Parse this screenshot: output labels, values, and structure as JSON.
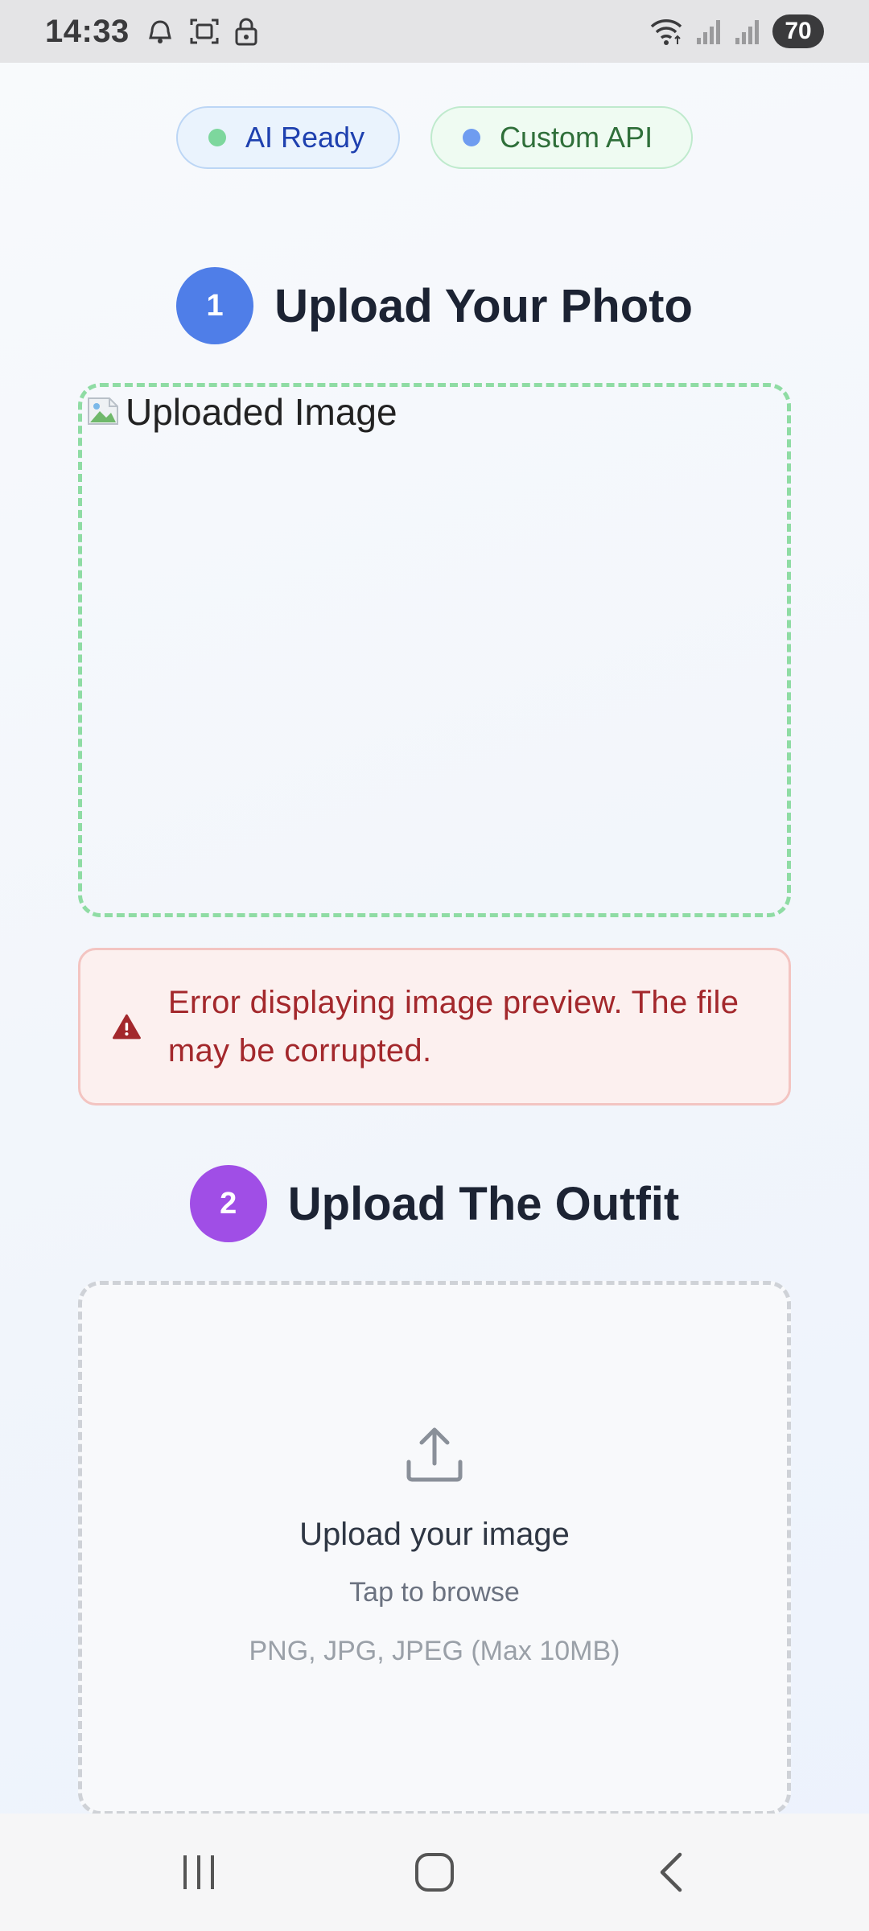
{
  "status_bar": {
    "time": "14:33",
    "battery": "70",
    "icons": [
      "alarm-icon",
      "screenshot-icon",
      "lock-icon",
      "wifi-icon",
      "signal-icon",
      "signal-icon"
    ]
  },
  "badges": {
    "ai_ready": "AI Ready",
    "custom_api": "Custom API",
    "ai_dot_color": "#7dd79d",
    "api_dot_color": "#6f9cf0"
  },
  "step1": {
    "number": "1",
    "title": "Upload Your Photo",
    "image_alt": "Uploaded Image",
    "error": "Error displaying image preview. The file may be corrupted."
  },
  "step2": {
    "number": "2",
    "title": "Upload The Outfit",
    "upload_title": "Upload your image",
    "upload_sub": "Tap to browse",
    "upload_note": "PNG, JPG, JPEG (Max 10MB)"
  },
  "nav": {
    "icons": [
      "recents-icon",
      "home-icon",
      "back-icon"
    ]
  },
  "colors": {
    "step1_accent": "#4f7ee8",
    "step2_accent": "#a04ee6",
    "error": "#a3282c",
    "success_border": "#8fdca4"
  }
}
